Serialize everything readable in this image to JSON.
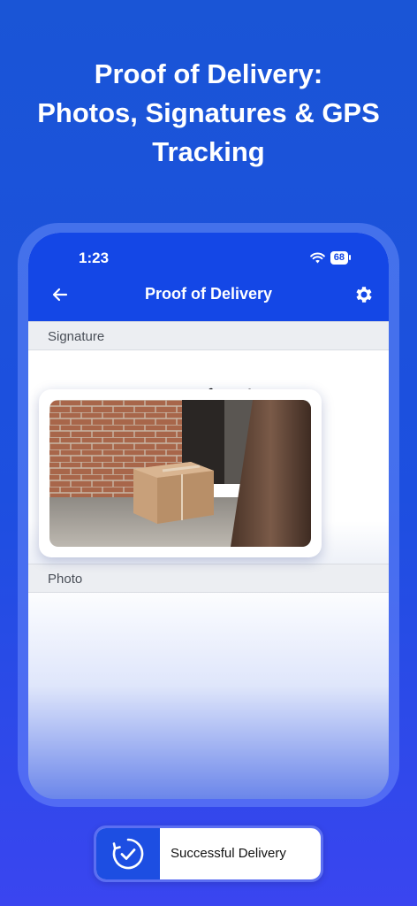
{
  "headline": {
    "line1": "Proof of Delivery:",
    "line2": "Photos, Signatures & GPS",
    "line3": "Tracking"
  },
  "status_bar": {
    "time": "1:23",
    "battery": "68"
  },
  "navbar": {
    "title": "Proof of Delivery",
    "back_icon": "arrow-left-icon",
    "settings_icon": "gear-icon"
  },
  "sections": {
    "signature_label": "Signature",
    "photo_label": "Photo"
  },
  "action": {
    "label": "Successful Delivery",
    "icon": "check-circle-icon"
  },
  "colors": {
    "brand_blue": "#1447e6",
    "background_blue": "#1d4fe0",
    "section_header_bg": "#eceef2"
  }
}
